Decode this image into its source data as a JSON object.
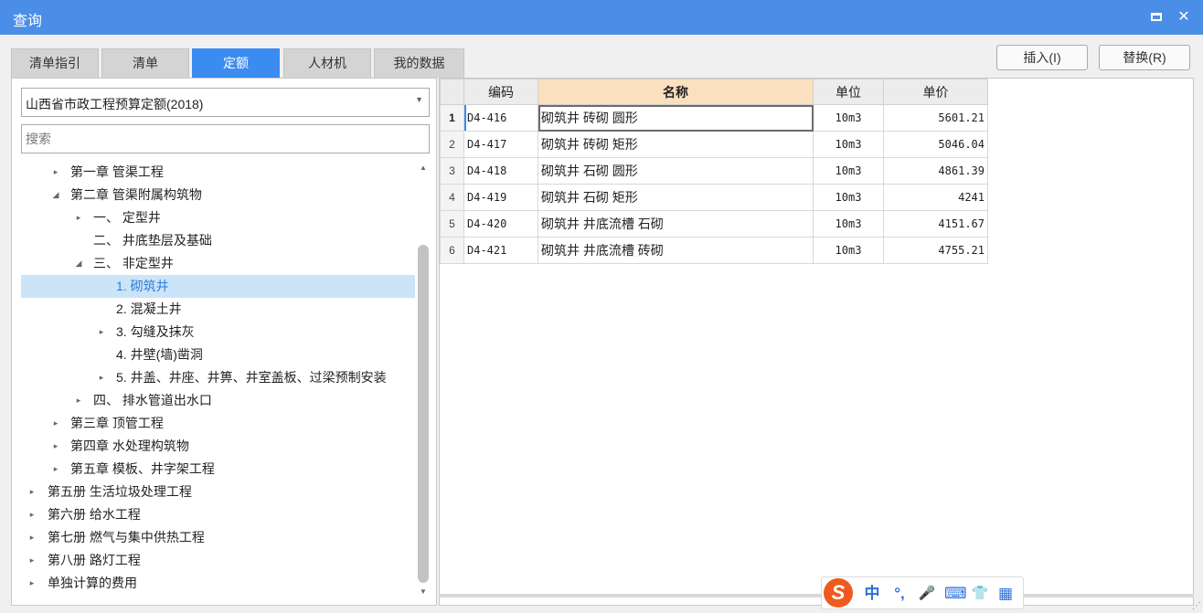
{
  "window": {
    "title": "查询",
    "maximize_icon": "maximize-icon",
    "close_icon": "close-icon",
    "close_glyph": "✕"
  },
  "tabs": [
    {
      "label": "清单指引",
      "active": false
    },
    {
      "label": "清单",
      "active": false
    },
    {
      "label": "定额",
      "active": true
    },
    {
      "label": "人材机",
      "active": false
    },
    {
      "label": "我的数据",
      "active": false
    }
  ],
  "actions": {
    "insert": "插入(I)",
    "replace": "替换(R)"
  },
  "library": {
    "selected": "山西省市政工程预算定额(2018)"
  },
  "search": {
    "placeholder": "搜索",
    "value": ""
  },
  "tree": [
    {
      "label": "第一章 管渠工程",
      "toggle": "▸",
      "selected": false
    },
    {
      "label": "第二章 管渠附属构筑物",
      "toggle": "◢",
      "selected": false
    },
    {
      "label": "一、 定型井",
      "toggle": "▸",
      "selected": false
    },
    {
      "label": "二、 井底垫层及基础",
      "toggle": "",
      "selected": false
    },
    {
      "label": "三、 非定型井",
      "toggle": "◢",
      "selected": false
    },
    {
      "label": "1. 砌筑井",
      "toggle": "",
      "selected": true
    },
    {
      "label": "2. 混凝土井",
      "toggle": "",
      "selected": false
    },
    {
      "label": "3. 勾缝及抹灰",
      "toggle": "▸",
      "selected": false
    },
    {
      "label": "4. 井壁(墙)凿洞",
      "toggle": "",
      "selected": false
    },
    {
      "label": "5. 井盖、井座、井箅、井室盖板、过梁预制安装",
      "toggle": "▸",
      "selected": false
    },
    {
      "label": "四、 排水管道出水口",
      "toggle": "▸",
      "selected": false
    },
    {
      "label": "第三章 顶管工程",
      "toggle": "▸",
      "selected": false
    },
    {
      "label": "第四章 水处理构筑物",
      "toggle": "▸",
      "selected": false
    },
    {
      "label": "第五章 模板、井字架工程",
      "toggle": "▸",
      "selected": false
    },
    {
      "label": "第五册 生活垃圾处理工程",
      "toggle": "▸",
      "selected": false
    },
    {
      "label": "第六册 给水工程",
      "toggle": "▸",
      "selected": false
    },
    {
      "label": "第七册 燃气与集中供热工程",
      "toggle": "▸",
      "selected": false
    },
    {
      "label": "第八册 路灯工程",
      "toggle": "▸",
      "selected": false
    },
    {
      "label": "单独计算的费用",
      "toggle": "▸",
      "selected": false
    }
  ],
  "grid": {
    "columns": [
      "",
      "编码",
      "名称",
      "单位",
      "单价"
    ],
    "rows": [
      {
        "n": "1",
        "code": "D4-416",
        "name": "砌筑井 砖砌 圆形",
        "unit": "10m3",
        "price": "5601.21"
      },
      {
        "n": "2",
        "code": "D4-417",
        "name": "砌筑井 砖砌 矩形",
        "unit": "10m3",
        "price": "5046.04"
      },
      {
        "n": "3",
        "code": "D4-418",
        "name": "砌筑井 石砌 圆形",
        "unit": "10m3",
        "price": "4861.39"
      },
      {
        "n": "4",
        "code": "D4-419",
        "name": "砌筑井 石砌 矩形",
        "unit": "10m3",
        "price": "4241"
      },
      {
        "n": "5",
        "code": "D4-420",
        "name": "砌筑井 井底流槽 石砌",
        "unit": "10m3",
        "price": "4151.67"
      },
      {
        "n": "6",
        "code": "D4-421",
        "name": "砌筑井 井底流槽 砖砌",
        "unit": "10m3",
        "price": "4755.21"
      }
    ]
  },
  "ime": {
    "logo": "S",
    "mode": "中",
    "punct": "°,",
    "mic": "🎤",
    "keyboard": "⌨",
    "skin": "👕",
    "menu": "▦"
  },
  "colors": {
    "titlebar": "#4a8ee8",
    "active_tab": "#3b8cf0",
    "selected_node": "#cce4f7",
    "highlight_header": "#fbe0bf"
  }
}
